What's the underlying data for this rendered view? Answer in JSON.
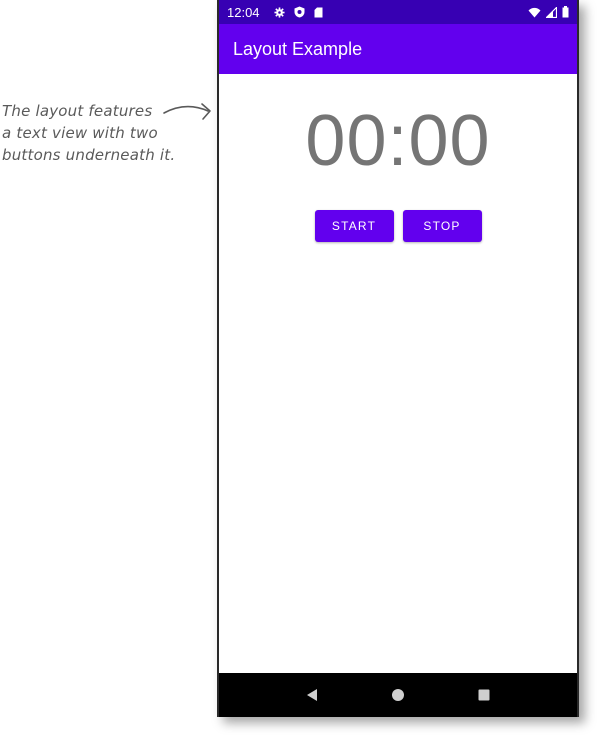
{
  "annotation": {
    "lines": [
      "The layout features",
      "a text view with two",
      "buttons underneath it."
    ]
  },
  "status_bar": {
    "time": "12:04",
    "left_icons": [
      "gear-icon",
      "shield-icon",
      "sd-card-icon"
    ],
    "right_icons": [
      "wifi-icon",
      "signal-icon",
      "battery-icon"
    ]
  },
  "app_bar": {
    "title": "Layout Example"
  },
  "main": {
    "time_text": "00:00",
    "start_label": "START",
    "stop_label": "STOP"
  },
  "nav_bar": {
    "buttons": [
      "back-icon",
      "home-icon",
      "recents-icon"
    ]
  },
  "colors": {
    "status_bar": "#3700b3",
    "app_bar": "#6200ee",
    "button": "#6200ee",
    "time_text": "#757575",
    "nav_bar": "#000000"
  }
}
